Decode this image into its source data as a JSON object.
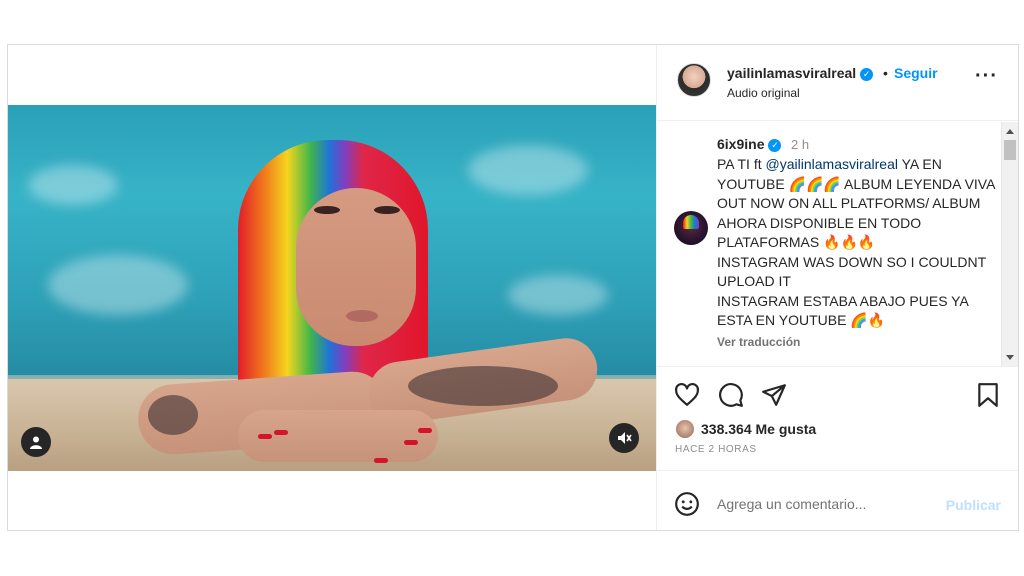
{
  "header": {
    "username": "yailinlamasviralreal",
    "separator": "•",
    "follow_label": "Seguir",
    "audio_label": "Audio original",
    "more_icon": "more-horizontal-icon"
  },
  "caption": {
    "username": "6ix9ine",
    "time": "2 h",
    "lines": {
      "l1a": "PA TI ft ",
      "mention": "@yailinlamasviralreal",
      "l1b": " YA EN YOUTUBE 🌈🌈🌈 ALBUM LEYENDA VIVA OUT NOW ON ALL PLATFORMS/ ALBUM AHORA DISPONIBLE EN TODO PLATAFORMAS 🔥🔥🔥",
      "l2": "INSTAGRAM WAS DOWN SO I COULDNT UPLOAD IT",
      "l3": "INSTAGRAM ESTABA ABAJO PUES YA ESTA EN YOUTUBE 🌈🔥"
    },
    "translate_label": "Ver traducción"
  },
  "actions": {
    "like_icon": "heart-icon",
    "comment_icon": "comment-icon",
    "share_icon": "send-icon",
    "save_icon": "bookmark-icon"
  },
  "likes": {
    "count_text": "338.364 Me gusta"
  },
  "timestamp": "HACE 2 HORAS",
  "comment": {
    "placeholder": "Agrega un comentario...",
    "publish_label": "Publicar"
  },
  "video": {
    "user_icon": "user-icon",
    "mute_icon": "muted-speaker-icon"
  },
  "colors": {
    "accent": "#0095f6",
    "publish_disabled": "#c0dffd",
    "text": "#262626",
    "muted_text": "#8e8e8e"
  }
}
